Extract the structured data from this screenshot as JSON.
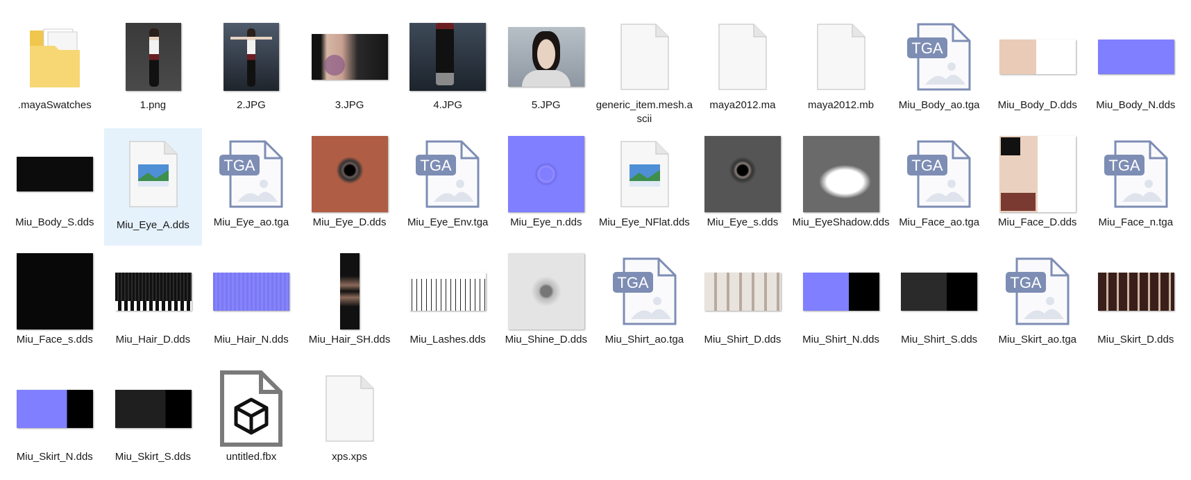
{
  "files": [
    {
      "name": ".mayaSwatches",
      "icon": "folder-icon"
    },
    {
      "name": "1.png",
      "icon": "image-thumbnail"
    },
    {
      "name": "2.JPG",
      "icon": "image-thumbnail"
    },
    {
      "name": "3.JPG",
      "icon": "image-thumbnail"
    },
    {
      "name": "4.JPG",
      "icon": "image-thumbnail"
    },
    {
      "name": "5.JPG",
      "icon": "image-thumbnail"
    },
    {
      "name": "generic_item.mesh.ascii",
      "icon": "blank-file-icon"
    },
    {
      "name": "maya2012.ma",
      "icon": "blank-file-icon"
    },
    {
      "name": "maya2012.mb",
      "icon": "blank-file-icon"
    },
    {
      "name": "Miu_Body_ao.tga",
      "icon": "tga-file-icon",
      "icon_text": "TGA"
    },
    {
      "name": "Miu_Body_D.dds",
      "icon": "image-thumbnail"
    },
    {
      "name": "Miu_Body_N.dds",
      "icon": "image-thumbnail"
    },
    {
      "name": "Miu_Body_S.dds",
      "icon": "image-thumbnail"
    },
    {
      "name": "Miu_Eye_A.dds",
      "icon": "picture-file-icon",
      "selected": true
    },
    {
      "name": "Miu_Eye_ao.tga",
      "icon": "tga-file-icon",
      "icon_text": "TGA"
    },
    {
      "name": "Miu_Eye_D.dds",
      "icon": "image-thumbnail"
    },
    {
      "name": "Miu_Eye_Env.tga",
      "icon": "tga-file-icon",
      "icon_text": "TGA"
    },
    {
      "name": "Miu_Eye_n.dds",
      "icon": "image-thumbnail"
    },
    {
      "name": "Miu_Eye_NFlat.dds",
      "icon": "picture-file-icon"
    },
    {
      "name": "Miu_Eye_s.dds",
      "icon": "image-thumbnail"
    },
    {
      "name": "Miu_EyeShadow.dds",
      "icon": "image-thumbnail"
    },
    {
      "name": "Miu_Face_ao.tga",
      "icon": "tga-file-icon",
      "icon_text": "TGA"
    },
    {
      "name": "Miu_Face_D.dds",
      "icon": "image-thumbnail"
    },
    {
      "name": "Miu_Face_n.tga",
      "icon": "tga-file-icon",
      "icon_text": "TGA"
    },
    {
      "name": "Miu_Face_s.dds",
      "icon": "image-thumbnail"
    },
    {
      "name": "Miu_Hair_D.dds",
      "icon": "image-thumbnail"
    },
    {
      "name": "Miu_Hair_N.dds",
      "icon": "image-thumbnail"
    },
    {
      "name": "Miu_Hair_SH.dds",
      "icon": "image-thumbnail"
    },
    {
      "name": "Miu_Lashes.dds",
      "icon": "image-thumbnail"
    },
    {
      "name": "Miu_Shine_D.dds",
      "icon": "image-thumbnail"
    },
    {
      "name": "Miu_Shirt_ao.tga",
      "icon": "tga-file-icon",
      "icon_text": "TGA"
    },
    {
      "name": "Miu_Shirt_D.dds",
      "icon": "image-thumbnail"
    },
    {
      "name": "Miu_Shirt_N.dds",
      "icon": "image-thumbnail"
    },
    {
      "name": "Miu_Shirt_S.dds",
      "icon": "image-thumbnail"
    },
    {
      "name": "Miu_Skirt_ao.tga",
      "icon": "tga-file-icon",
      "icon_text": "TGA"
    },
    {
      "name": "Miu_Skirt_D.dds",
      "icon": "image-thumbnail"
    },
    {
      "name": "Miu_Skirt_N.dds",
      "icon": "image-thumbnail"
    },
    {
      "name": "Miu_Skirt_S.dds",
      "icon": "image-thumbnail"
    },
    {
      "name": "untitled.fbx",
      "icon": "3d-object-file-icon"
    },
    {
      "name": "xps.xps",
      "icon": "blank-file-icon"
    }
  ],
  "colors": {
    "selection": "#e5f1fb",
    "tga_badge": "#7d8db4",
    "normal_map": "#7f7fff"
  }
}
